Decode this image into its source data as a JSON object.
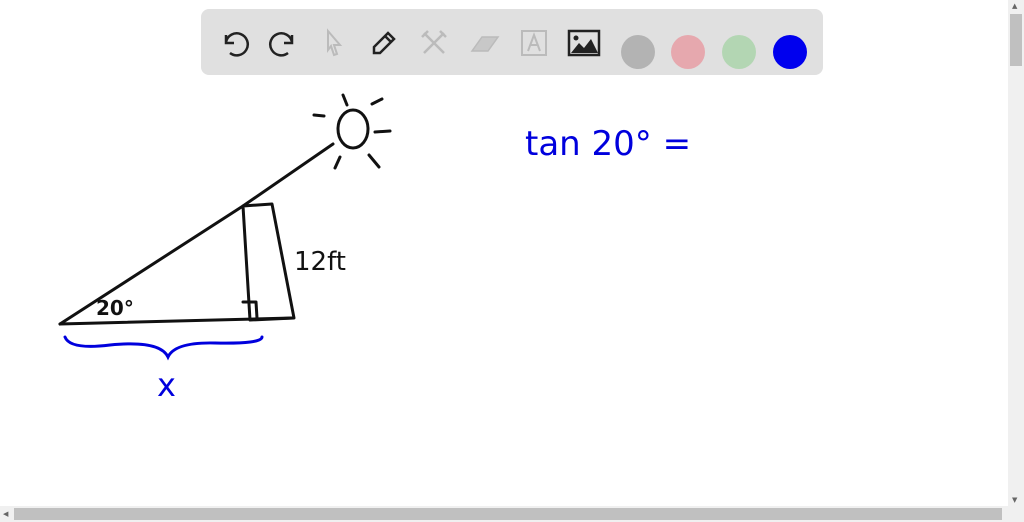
{
  "toolbar": {
    "tools": [
      "undo-icon",
      "redo-icon",
      "select-icon",
      "pen-icon",
      "tools-icon",
      "eraser-icon",
      "text-icon",
      "image-icon"
    ],
    "colors": [
      "#b3b3b3",
      "#e6a8ae",
      "#b3d6b3",
      "#0000ee"
    ]
  },
  "drawing": {
    "equation": "tan 20° =",
    "height_label": "12ft",
    "angle_label": "20°",
    "base_label": "x",
    "ink_black": "#111111",
    "ink_blue": "#0000dd"
  },
  "scrollbar": {
    "up": "▲",
    "down": "▼",
    "left": "◀",
    "right": "▶"
  }
}
